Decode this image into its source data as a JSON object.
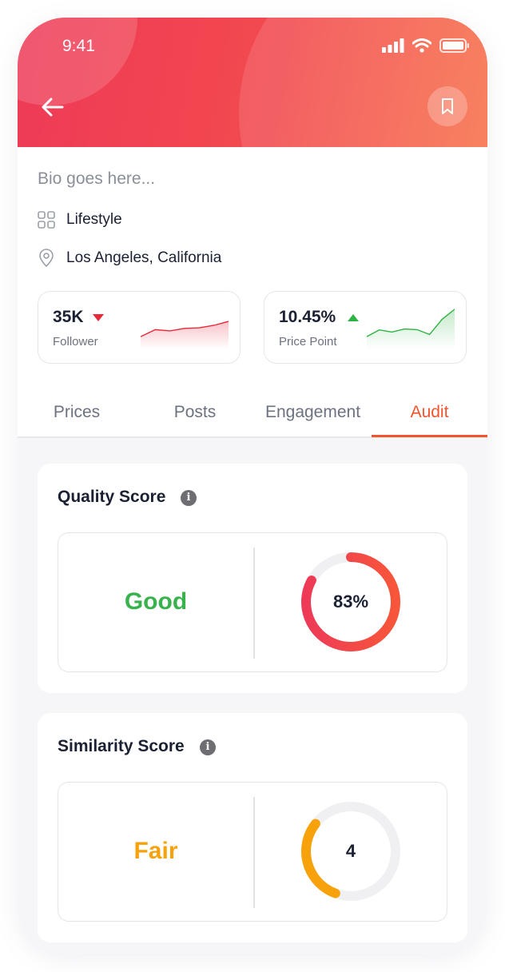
{
  "status_bar": {
    "time": "9:41"
  },
  "profile": {
    "bio": "Bio goes here...",
    "category": "Lifestyle",
    "location": "Los Angeles, California"
  },
  "stats": [
    {
      "value": "35K",
      "label": "Follower",
      "trend": "down",
      "color": "#e8293a",
      "sparkline": [
        0.95,
        0.72,
        0.76,
        0.68,
        0.66,
        0.58,
        0.45
      ]
    },
    {
      "value": "10.45%",
      "label": "Price Point",
      "trend": "up",
      "color": "#2fb344",
      "sparkline": [
        0.95,
        0.73,
        0.8,
        0.7,
        0.72,
        0.88,
        0.38,
        0.05
      ]
    }
  ],
  "tabs": [
    {
      "label": "Prices",
      "active": false
    },
    {
      "label": "Posts",
      "active": false
    },
    {
      "label": "Engagement",
      "active": false
    },
    {
      "label": "Audit",
      "active": true
    }
  ],
  "cards": {
    "quality": {
      "title": "Quality Score",
      "rating": "Good",
      "rating_color": "#37b24d",
      "progress_text": "83%",
      "progress": 0.83
    },
    "similarity": {
      "title": "Similarity Score",
      "rating": "Fair",
      "rating_color": "#f7a20a",
      "progress_text": "4",
      "progress": 0.3
    }
  },
  "icons": [
    "signal-icon",
    "wifi-icon",
    "battery-icon",
    "back-arrow-icon",
    "bookmark-icon",
    "grid-icon",
    "location-pin-icon",
    "info-icon"
  ],
  "colors": {
    "accent": "#f2542d",
    "header_start": "#ee3a57",
    "header_end": "#f7704a"
  }
}
